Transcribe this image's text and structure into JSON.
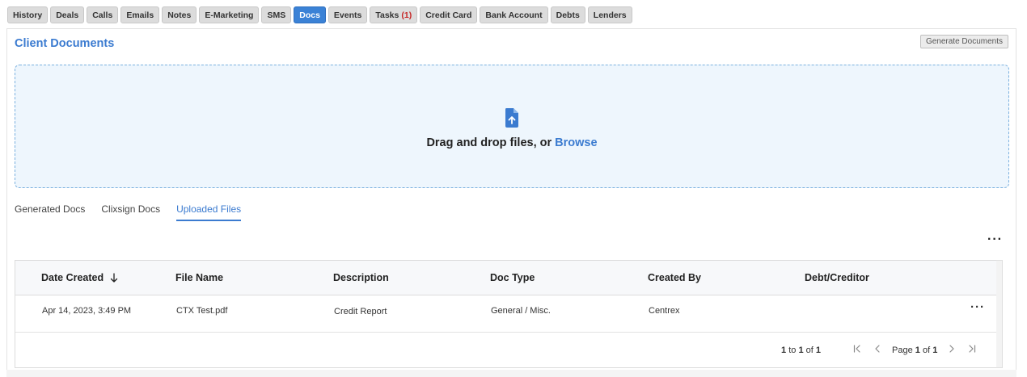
{
  "nav": {
    "tabs": [
      {
        "label": "History"
      },
      {
        "label": "Deals"
      },
      {
        "label": "Calls"
      },
      {
        "label": "Emails"
      },
      {
        "label": "Notes"
      },
      {
        "label": "E-Marketing"
      },
      {
        "label": "SMS"
      },
      {
        "label": "Docs",
        "active": true
      },
      {
        "label": "Events"
      },
      {
        "label": "Tasks",
        "count": "(1)"
      },
      {
        "label": "Credit Card"
      },
      {
        "label": "Bank Account"
      },
      {
        "label": "Debts"
      },
      {
        "label": "Lenders"
      }
    ]
  },
  "card": {
    "title": "Client Documents",
    "generate_label": "Generate Documents"
  },
  "dropzone": {
    "text": "Drag and drop files, or ",
    "browse": "Browse"
  },
  "doc_tabs": [
    {
      "label": "Generated Docs"
    },
    {
      "label": "Clixsign Docs"
    },
    {
      "label": "Uploaded Files",
      "active": true
    }
  ],
  "table": {
    "columns": [
      "Date Created",
      "File Name",
      "Description",
      "Doc Type",
      "Created By",
      "Debt/Creditor"
    ],
    "sort_column": "Date Created",
    "sort_direction": "descending",
    "rows": [
      {
        "date_created": "Apr 14, 2023, 3:49 PM",
        "file_name": "CTX Test.pdf",
        "description": "Credit Report",
        "doc_type": "General / Misc.",
        "created_by": "Centrex",
        "debt_creditor": ""
      }
    ],
    "pager": {
      "from": "1",
      "to_word": "to",
      "to": "1",
      "of_word": "of",
      "total": "1",
      "page_word": "Page",
      "page": "1",
      "page_of": "of",
      "page_total": "1"
    }
  },
  "colors": {
    "accent": "#3b7bd0",
    "active_tab": "#3b82d6",
    "dropzone_bg": "#eef6fd",
    "task_count": "#c62828"
  }
}
